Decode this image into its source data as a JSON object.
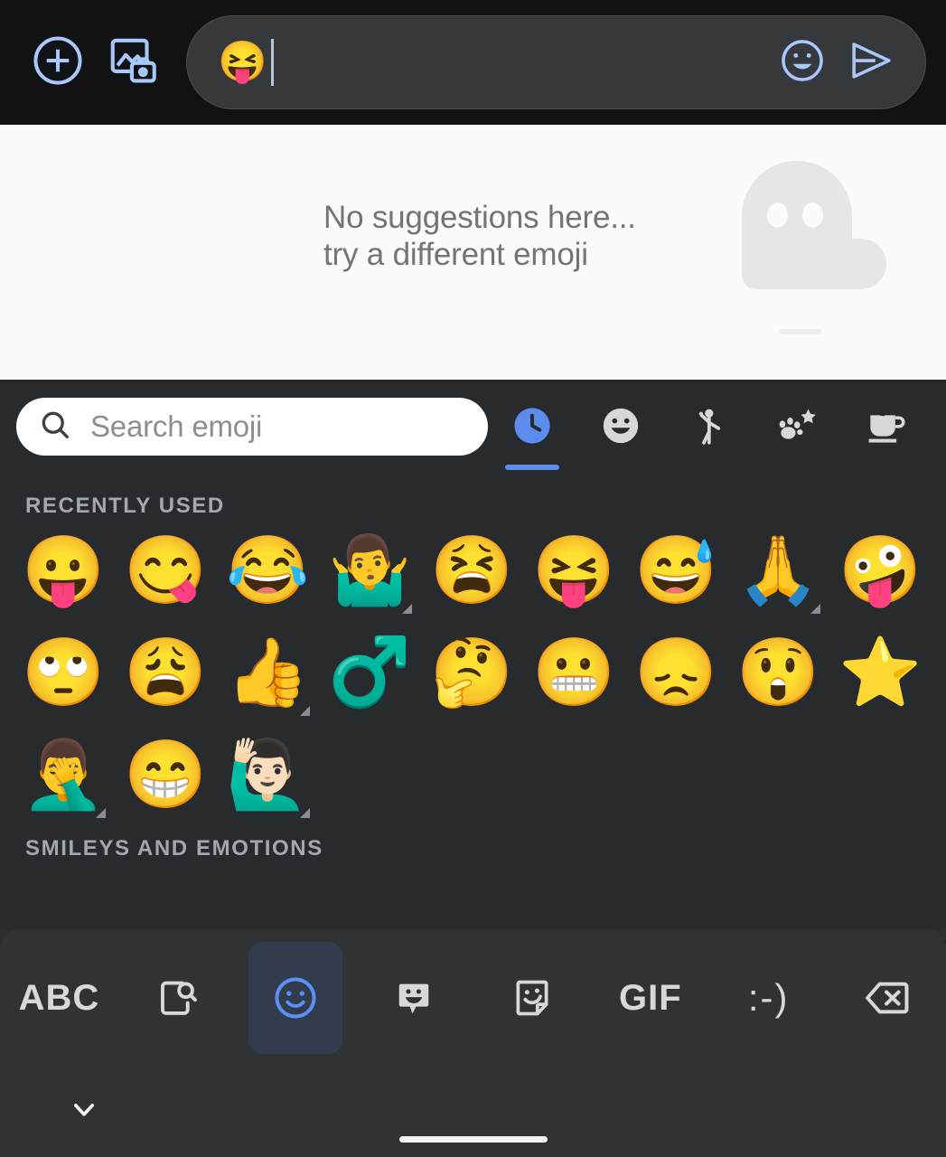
{
  "colors": {
    "compose_bar_bg": "#111213",
    "compose_icon_blue": "#a8c7fa",
    "picker_bg": "#282b2e",
    "accent_blue": "#5b8def",
    "keyboard_bg": "#303336",
    "active_key_bg": "#333c4d",
    "active_key_icon": "#5b91f5",
    "category_icon_gray": "#d6d9dc",
    "section_label_gray": "#a4a8ac",
    "empty_text_gray": "#70757a",
    "ghost_gray": "#e4e6e7",
    "search_field_bg": "#ffffff",
    "search_placeholder_gray": "#8b8f94"
  },
  "compose_bar": {
    "add_button": "add-circle-icon",
    "gallery_button": "gallery-camera-icon",
    "input_value": "😝",
    "emoji_button": "emoji-smiley-icon",
    "send_button": "send-icon"
  },
  "suggestion_panel": {
    "empty_message": "No suggestions here...\ntry a different emoji",
    "illustration": "ghost-illustration"
  },
  "picker": {
    "search": {
      "icon": "search-icon",
      "placeholder": "Search emoji",
      "value": ""
    },
    "category_tabs": [
      {
        "name": "recently-used",
        "icon": "clock-icon",
        "active": true
      },
      {
        "name": "smileys-and-emotions",
        "icon": "smiley-icon",
        "active": false
      },
      {
        "name": "people",
        "icon": "person-waving-icon",
        "active": false
      },
      {
        "name": "animals-and-nature",
        "icon": "paw-star-icon",
        "active": false
      },
      {
        "name": "food-and-drink",
        "icon": "teacup-icon",
        "active": false
      }
    ],
    "sections": [
      {
        "label": "RECENTLY USED",
        "emojis": [
          {
            "char": "😛",
            "name": "face-with-tongue",
            "variants": false
          },
          {
            "char": "😋",
            "name": "face-savoring-food",
            "variants": false
          },
          {
            "char": "😂",
            "name": "face-with-tears-of-joy",
            "variants": false
          },
          {
            "char": "🤷‍♂️",
            "name": "man-shrugging",
            "variants": true
          },
          {
            "char": "😫",
            "name": "tired-face",
            "variants": false
          },
          {
            "char": "😝",
            "name": "squinting-face-with-tongue",
            "variants": false
          },
          {
            "char": "😅",
            "name": "grinning-face-with-sweat",
            "variants": false
          },
          {
            "char": "🙏",
            "name": "folded-hands",
            "variants": true
          },
          {
            "char": "🤪",
            "name": "zany-face",
            "variants": false
          },
          {
            "char": "🙄",
            "name": "face-with-rolling-eyes",
            "variants": false
          },
          {
            "char": "😩",
            "name": "weary-face",
            "variants": false
          },
          {
            "char": "👍",
            "name": "thumbs-up",
            "variants": true
          },
          {
            "char": "♂️",
            "name": "male-sign",
            "variants": false
          },
          {
            "char": "🤔",
            "name": "thinking-face",
            "variants": false
          },
          {
            "char": "😬",
            "name": "grimacing-face",
            "variants": false
          },
          {
            "char": "😞",
            "name": "disappointed-face",
            "variants": false
          },
          {
            "char": "😲",
            "name": "astonished-face",
            "variants": false
          },
          {
            "char": "⭐",
            "name": "star",
            "variants": false
          },
          {
            "char": "🤦‍♂️",
            "name": "man-facepalming",
            "variants": true
          },
          {
            "char": "😁",
            "name": "beaming-face-with-smiling-eyes",
            "variants": false
          },
          {
            "char": "🙋🏻‍♂️",
            "name": "man-raising-hand-light-skin-tone",
            "variants": true
          }
        ]
      },
      {
        "label": "SMILEYS AND EMOTIONS",
        "emojis": []
      }
    ]
  },
  "keyboard_toolbar": {
    "keys": [
      {
        "name": "abc-key",
        "label": "ABC",
        "type": "text",
        "active": false
      },
      {
        "name": "search-page-key",
        "label": "",
        "type": "icon",
        "icon": "page-search-icon",
        "active": false
      },
      {
        "name": "emoji-key",
        "label": "",
        "type": "icon",
        "icon": "emoji-smiley-icon",
        "active": true
      },
      {
        "name": "emoji-kitchen-key",
        "label": "",
        "type": "icon",
        "icon": "emoji-kitchen-icon",
        "active": false
      },
      {
        "name": "sticker-key",
        "label": "",
        "type": "icon",
        "icon": "sticker-icon",
        "active": false
      },
      {
        "name": "gif-key",
        "label": "GIF",
        "type": "text",
        "active": false
      },
      {
        "name": "emoticon-key",
        "label": ":-)",
        "type": "text",
        "active": false
      },
      {
        "name": "backspace-key",
        "label": "",
        "type": "icon",
        "icon": "backspace-icon",
        "active": false
      }
    ]
  },
  "nav_bar": {
    "hide_keyboard": "chevron-down-icon",
    "home_indicator": "home-indicator"
  }
}
